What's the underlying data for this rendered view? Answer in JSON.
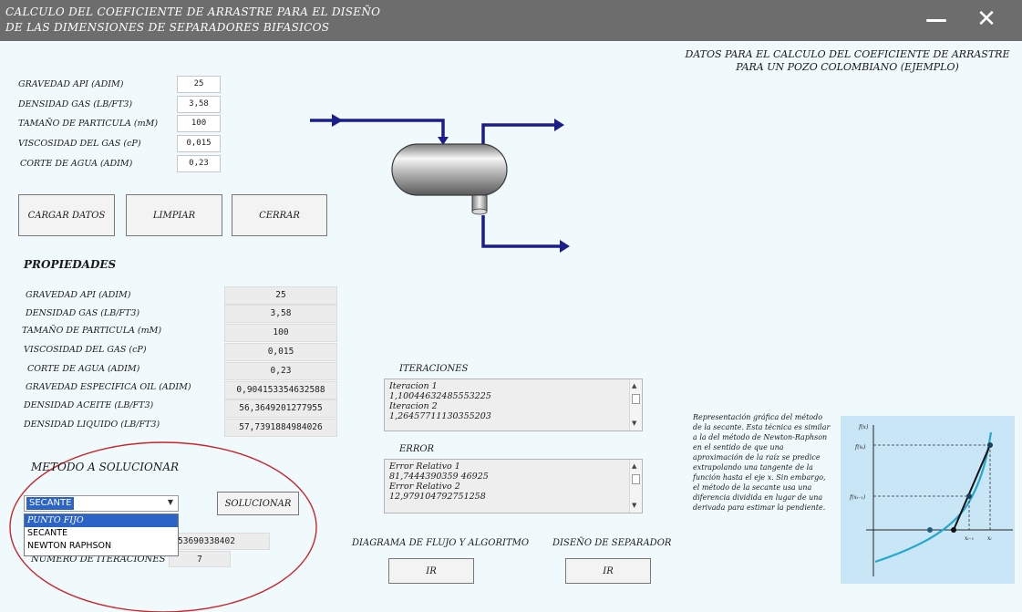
{
  "window": {
    "title_line1": "CALCULO DEL COEFICIENTE DE ARRASTRE PARA EL DISEÑO",
    "title_line2": "DE LAS DIMENSIONES DE SEPARADORES BIFASICOS",
    "minimize_glyph": "—",
    "close_glyph": "✕"
  },
  "header_note": {
    "line1": "DATOS PARA EL CALCULO DEL COEFICIENTE DE ARRASTRE",
    "line2": "PARA UN POZO COLOMBIANO (EJEMPLO)"
  },
  "inputs": {
    "api_label": "GRAVEDAD API (ADIM)",
    "api_value": "25",
    "gas_density_label": "DENSIDAD GAS (LB/FT3)",
    "gas_density_value": "3,58",
    "particle_label": "TAMAÑO DE PARTICULA (mM)",
    "particle_value": "100",
    "viscosity_label": "VISCOSIDAD DEL GAS (cP)",
    "viscosity_value": "0,015",
    "water_cut_label": "CORTE DE AGUA (ADIM)",
    "water_cut_value": "0,23"
  },
  "buttons": {
    "load": "CARGAR DATOS",
    "clear": "LIMPIAR",
    "close": "CERRAR"
  },
  "properties": {
    "heading": "PROPIEDADES",
    "rows": [
      {
        "label": "GRAVEDAD API (ADIM)",
        "value": "25"
      },
      {
        "label": "DENSIDAD GAS (LB/FT3)",
        "value": "3,58"
      },
      {
        "label": "TAMAÑO DE PARTICULA (mM)",
        "value": "100"
      },
      {
        "label": "VISCOSIDAD DEL GAS (cP)",
        "value": "0,015"
      },
      {
        "label": "CORTE DE AGUA (ADIM)",
        "value": "0,23"
      },
      {
        "label": "GRAVEDAD ESPECIFICA OIL (ADIM)",
        "value": "0,904153354632588"
      },
      {
        "label": "DENSIDAD ACEITE (LB/FT3)",
        "value": "56,3649201277955"
      },
      {
        "label": "DENSIDAD LIQUIDO  (LB/FT3)",
        "value": "57,7391884984026"
      }
    ]
  },
  "iterations": {
    "heading": "ITERACIONES",
    "lines": [
      "Iteracion  1",
      "1,10044632485553225",
      "Iteracion  2",
      "1,26457711130355203"
    ]
  },
  "error": {
    "heading": "ERROR",
    "lines": [
      "Error Relativo  1",
      "81,7444390359 46925",
      "Error Relativo  2",
      "12,979104792751258"
    ]
  },
  "method": {
    "heading": "METODO A SOLUCIONAR",
    "selected": "SECANTE",
    "options": [
      "PUNTO FIJO",
      "SECANTE",
      "NEWTON RAPHSON"
    ],
    "solve_button": "SOLUCIONAR",
    "result_value": "53690338402",
    "iterations_label": "NUMERO DE ITERACIONES",
    "iterations_value": "7"
  },
  "flow": {
    "label": "DIAGRAMA DE FLUJO Y ALGORITMO",
    "button": "IR"
  },
  "design": {
    "label": "DISEÑO DE SEPARADOR",
    "button": "IR"
  },
  "secant_description": "Representación gráfica del método de la secante. Esta técnica es similar a la del método de Newton-Raphson en el sentido de que una aproximación de la raíz se predice extrapolando una tangente de la función hasta el eje x. Sin embargo, el método de la secante usa una diferencia dividida en lugar de una derivada para estimar la pendiente.",
  "graph_labels": {
    "fx": "f(x)",
    "fxi": "f(xᵢ)",
    "fxim1": "f(xᵢ₋₁)",
    "xim1": "xᵢ₋₁",
    "xi": "xᵢ"
  },
  "colors": {
    "pipe": "#1c1c8a",
    "curve": "#25a7cf",
    "graph_bg": "#c9e6f7",
    "oval": "#c9252b",
    "select_highlight": "#2b63c6"
  }
}
